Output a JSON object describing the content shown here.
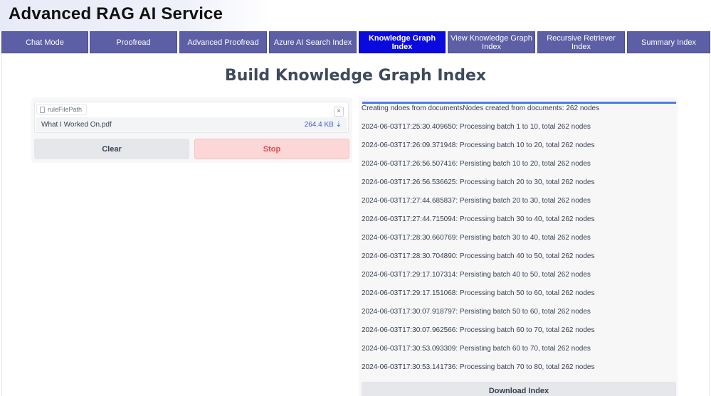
{
  "app": {
    "title": "Advanced RAG AI Service"
  },
  "tabs": [
    {
      "label": "Chat Mode",
      "active": false
    },
    {
      "label": "Proofread",
      "active": false
    },
    {
      "label": "Advanced Proofread",
      "active": false
    },
    {
      "label": "Azure AI Search Index",
      "active": false
    },
    {
      "label": "Knowledge Graph Index",
      "active": true
    },
    {
      "label": "View Knowledge Graph Index",
      "active": false
    },
    {
      "label": "Recursive Retriever Index",
      "active": false
    },
    {
      "label": "Summary Index",
      "active": false
    }
  ],
  "page": {
    "title": "Build Knowledge Graph Index"
  },
  "file_upload": {
    "label": "ruleFilePath",
    "close_symbol": "×",
    "file_name": "What I Worked On.pdf",
    "file_size": "264.4 KB ⇣"
  },
  "buttons": {
    "clear": "Clear",
    "stop": "Stop",
    "download": "Download Index"
  },
  "log": [
    "Creating ndoes from documentsNodes created from documents: 262 nodes",
    "2024-06-03T17:25:30.409650: Processing batch 1 to 10, total 262 nodes",
    "2024-06-03T17:26:09.371948: Processing batch 10 to 20, total 262 nodes",
    "2024-06-03T17:26:56.507416: Persisting batch 10 to 20, total 262 nodes",
    "2024-06-03T17:26:56.536625: Processing batch 20 to 30, total 262 nodes",
    "2024-06-03T17:27:44.685837: Persisting batch 20 to 30, total 262 nodes",
    "2024-06-03T17:27:44.715094: Processing batch 30 to 40, total 262 nodes",
    "2024-06-03T17:28:30.660769: Persisting batch 30 to 40, total 262 nodes",
    "2024-06-03T17:28:30.704890: Processing batch 40 to 50, total 262 nodes",
    "2024-06-03T17:29:17.107314: Persisting batch 40 to 50, total 262 nodes",
    "2024-06-03T17:29:17.151068: Processing batch 50 to 60, total 262 nodes",
    "2024-06-03T17:30:07.918797: Persisting batch 50 to 60, total 262 nodes",
    "2024-06-03T17:30:07.962566: Processing batch 60 to 70, total 262 nodes",
    "2024-06-03T17:30:53.093309: Persisting batch 60 to 70, total 262 nodes",
    "2024-06-03T17:30:53.141736: Processing batch 70 to 80, total 262 nodes"
  ],
  "colors": {
    "tab_bg": "#5c5ea6",
    "tab_active_bg": "#0a0adf",
    "stop_bg": "#fcd7d7",
    "stop_text": "#e04b4b",
    "progress": "#4a7ee8",
    "file_size_link": "#3b5bdb"
  }
}
